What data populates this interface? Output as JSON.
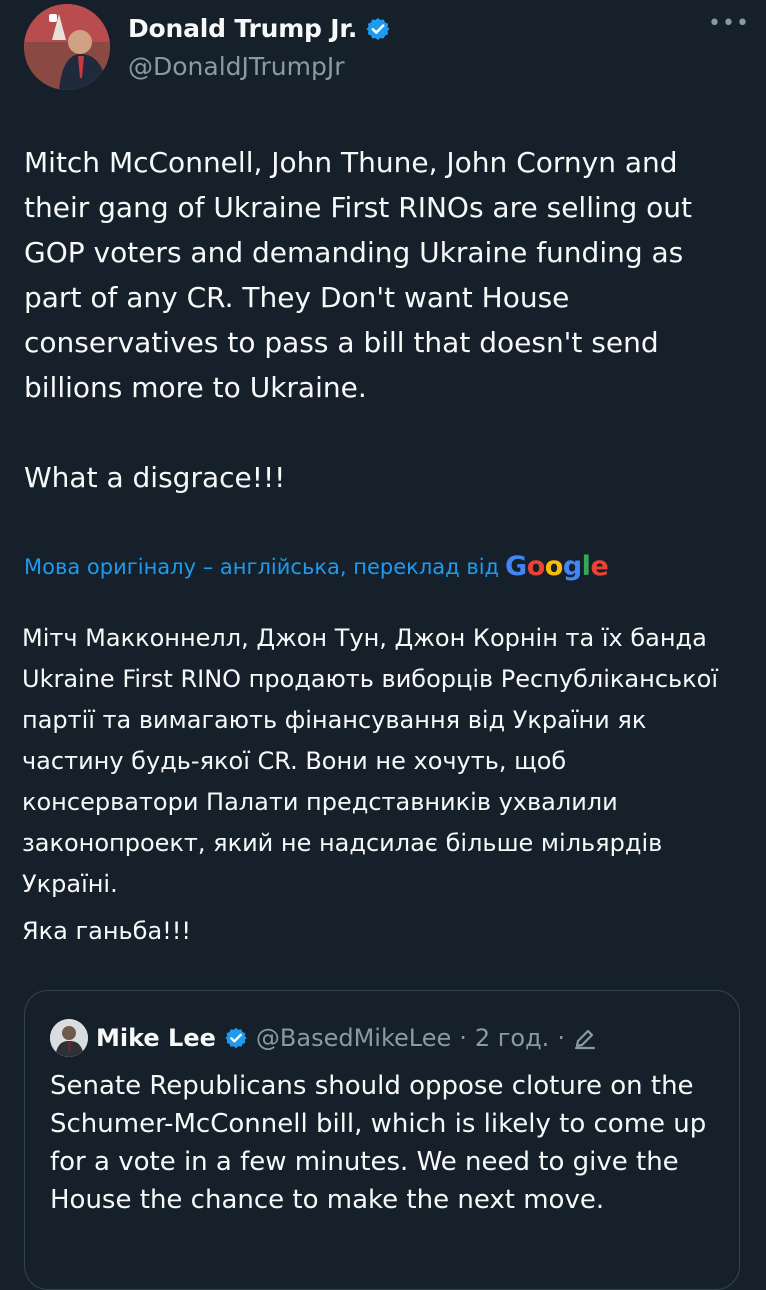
{
  "author": {
    "name": "Donald Trump Jr.",
    "handle": "@DonaldJTrumpJr",
    "verified_icon": "verified-badge-icon",
    "more_icon": "more-horizontal-icon"
  },
  "tweet": {
    "paragraphs": [
      "Mitch McConnell, John Thune, John Cornyn and their gang of Ukraine First RINOs are selling out GOP voters and demanding Ukraine funding as part of any CR. They Don't want House conservatives to pass a bill that doesn't send billions more to Ukraine.",
      "What a disgrace!!!"
    ]
  },
  "translation": {
    "label": "Мова оригіналу – англійська, переклад від",
    "provider_letters": [
      "G",
      "o",
      "o",
      "g",
      "l",
      "e"
    ],
    "paragraphs": [
      "Мітч Макконнелл, Джон Тун, Джон Корнін та їх банда Ukraine First RINO продають виборців Республіканської партії та вимагають фінансування від України як частину будь-якої CR. Вони не хочуть, щоб консерватори Палати представників ухвалили законопроект, який не надсилає більше мільярдів Україні.",
      "Яка ганьба!!!"
    ]
  },
  "quote": {
    "name": "Mike Lee",
    "handle": "@BasedMikeLee",
    "separator_1": "·",
    "time": "2 год.",
    "separator_2": "·",
    "text": "Senate Republicans should oppose cloture on the Schumer-McConnell bill, which is likely to come up for a vote in a few minutes. We need to give the House the chance to make the next move."
  },
  "colors": {
    "background": "#15202b",
    "text": "#f7f9f9",
    "muted": "#8b98a5",
    "accent": "#1d9bf0",
    "border": "#38444d"
  }
}
